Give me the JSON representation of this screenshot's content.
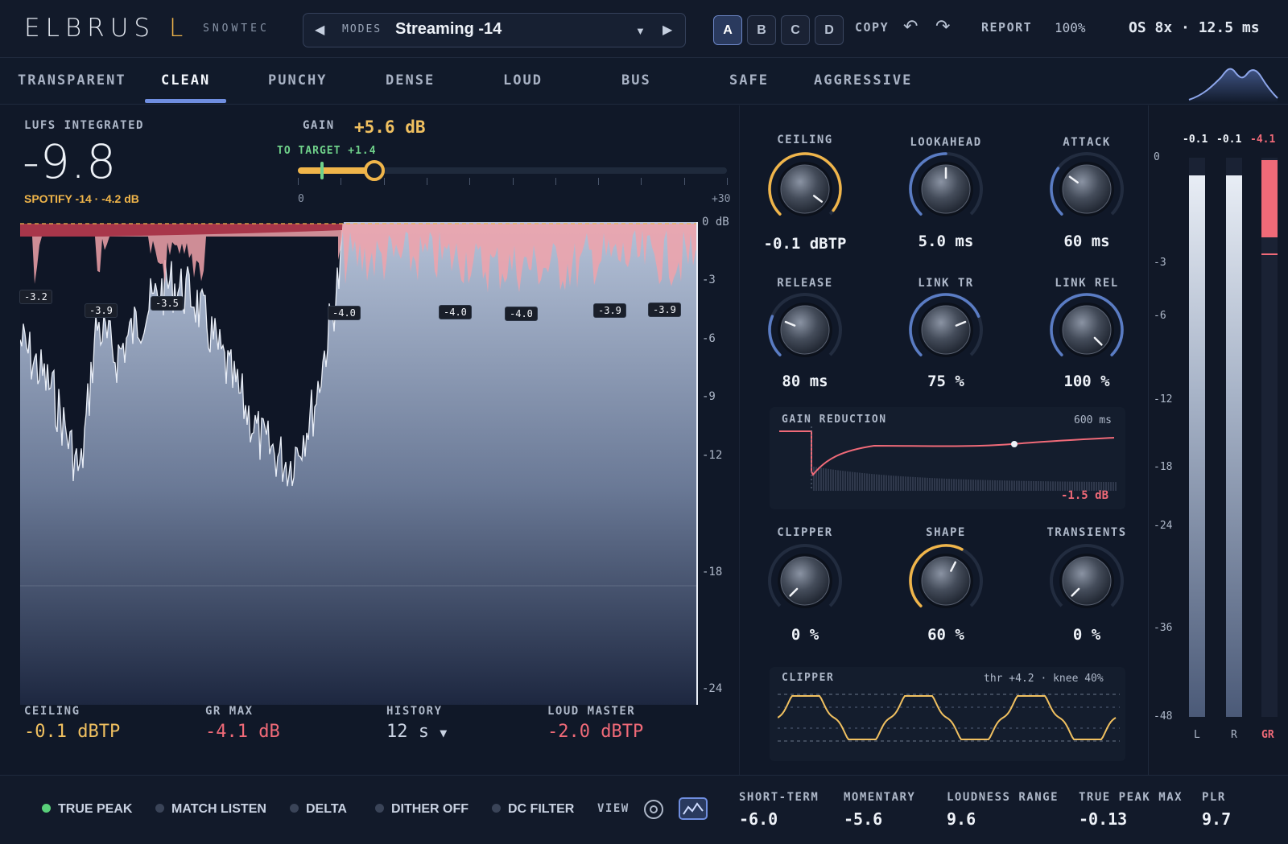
{
  "header": {
    "brand": "ELBRUS",
    "brand_accent": "L",
    "brand_sub": "SNOWTEC",
    "preset_label": "MODES",
    "preset_value": "Streaming -14",
    "slots": [
      "A",
      "B",
      "C",
      "D"
    ],
    "active_slot": "A",
    "copy_label": "COPY",
    "report_label": "REPORT",
    "zoom": "100%",
    "os_info": "OS 8x · 12.5 ms"
  },
  "tabs": [
    "TRANSPARENT",
    "CLEAN",
    "PUNCHY",
    "DENSE",
    "LOUD",
    "BUS",
    "SAFE",
    "AGGRESSIVE"
  ],
  "active_tab": "CLEAN",
  "loudness": {
    "label": "LUFS INTEGRATED",
    "value": "-9.8",
    "target_note": "SPOTIFY -14 · -4.2 dB"
  },
  "gain": {
    "label": "GAIN",
    "value": "+5.6 dB",
    "to_target": "TO TARGET +1.4",
    "min_label": "0",
    "max_label": "+30",
    "range": [
      0,
      30
    ],
    "current": 5.6,
    "target_position": 1.4
  },
  "waveform": {
    "scale": [
      "0 dB",
      "-3",
      "-6",
      "-9",
      "-12",
      "-18",
      "-24"
    ],
    "gr_tags": [
      "-3.2",
      "-3.9",
      "-3.5",
      "-4.0",
      "-4.0",
      "-4.0",
      "-3.9",
      "-3.9"
    ]
  },
  "bottom_stats": [
    {
      "label": "CEILING",
      "value": "-0.1 dBTP",
      "color": "#f0c060"
    },
    {
      "label": "GR MAX",
      "value": "-4.1 dB",
      "color": "#f06a78"
    },
    {
      "label": "HISTORY",
      "value": "12 s",
      "color": "#c9d2e2"
    },
    {
      "label": "LOUD MASTER",
      "value": "-2.0 dBTP",
      "color": "#f06a78"
    }
  ],
  "history_dropdown_icon": "caret-down-icon",
  "knobs": {
    "ceiling": {
      "label": "CEILING",
      "value": "-0.1 dBTP",
      "level": 0.97,
      "accent": "#f0b54a"
    },
    "lookahead": {
      "label": "LOOKAHEAD",
      "value": "5.0 ms",
      "level": 0.5,
      "accent": "#5a7cc4"
    },
    "attack": {
      "label": "ATTACK",
      "value": "60 ms",
      "level": 0.3,
      "accent": "#5a7cc4"
    },
    "release": {
      "label": "RELEASE",
      "value": "80 ms",
      "level": 0.25,
      "accent": "#5a7cc4"
    },
    "link_tr": {
      "label": "LINK TR",
      "value": "75 %",
      "level": 0.75,
      "accent": "#5a7cc4"
    },
    "link_rel": {
      "label": "LINK REL",
      "value": "100 %",
      "level": 1.0,
      "accent": "#5a7cc4"
    },
    "clipper": {
      "label": "CLIPPER",
      "value": "0 %",
      "level": 0.0,
      "accent": "#5a7cc4"
    },
    "shape": {
      "label": "SHAPE",
      "value": "60 %",
      "level": 0.6,
      "accent": "#f0b54a"
    },
    "transients": {
      "label": "TRANSIENTS",
      "value": "0 %",
      "level": 0.0,
      "accent": "#5a7cc4"
    }
  },
  "gr_panel": {
    "title": "GAIN REDUCTION",
    "time": "600 ms",
    "value": "-1.5 dB"
  },
  "clip_panel": {
    "title": "CLIPPER",
    "info": "thr +4.2 · knee 40%"
  },
  "meters": {
    "peaks": [
      "-0.1",
      "-0.1",
      "-4.1"
    ],
    "scale": [
      "0",
      "-3",
      "-6",
      "-12",
      "-18",
      "-24",
      "-36",
      "-48"
    ],
    "channels": [
      "L",
      "R",
      "GR"
    ],
    "levels": {
      "L": -0.1,
      "R": -0.1,
      "GR": -4.1
    }
  },
  "footer": {
    "toggles": [
      {
        "label": "TRUE PEAK",
        "on": true
      },
      {
        "label": "MATCH LISTEN",
        "on": false
      },
      {
        "label": "DELTA",
        "on": false
      },
      {
        "label": "DITHER OFF",
        "on": false
      },
      {
        "label": "DC FILTER",
        "on": false
      }
    ],
    "view_label": "VIEW",
    "stats": [
      {
        "label": "SHORT-TERM",
        "value": "-6.0"
      },
      {
        "label": "MOMENTARY",
        "value": "-5.6"
      },
      {
        "label": "LOUDNESS RANGE",
        "value": "9.6"
      },
      {
        "label": "TRUE PEAK MAX",
        "value": "-0.13"
      },
      {
        "label": "PLR",
        "value": "9.7"
      }
    ]
  }
}
